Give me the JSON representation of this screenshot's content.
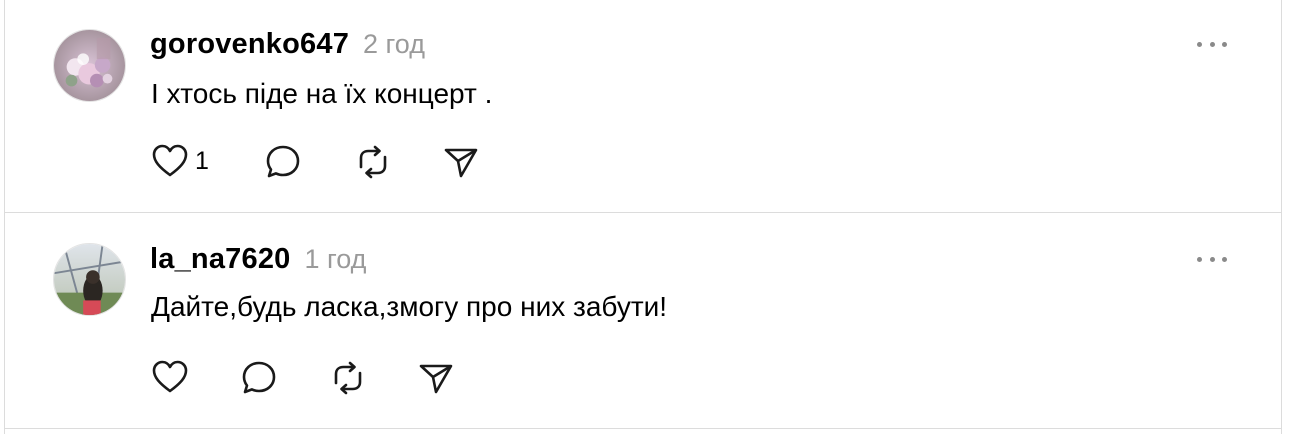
{
  "posts": [
    {
      "username": "gorovenko647",
      "time": "2 год",
      "text": "І хтось піде на їх концерт .",
      "like_count": "1",
      "icons": [
        "avatar",
        "more-icon",
        "heart-icon",
        "comment-icon",
        "repost-icon",
        "share-icon"
      ]
    },
    {
      "username": "la_na7620",
      "time": "1 год",
      "text": "Дайте,будь ласка,змогу про них забути!",
      "like_count": "",
      "icons": [
        "avatar",
        "more-icon",
        "heart-icon",
        "comment-icon",
        "repost-icon",
        "share-icon"
      ]
    }
  ],
  "colors": {
    "text": "#000000",
    "muted": "#9a9a9a",
    "divider": "#dcdcdc",
    "icon": "#1a1a1a"
  }
}
